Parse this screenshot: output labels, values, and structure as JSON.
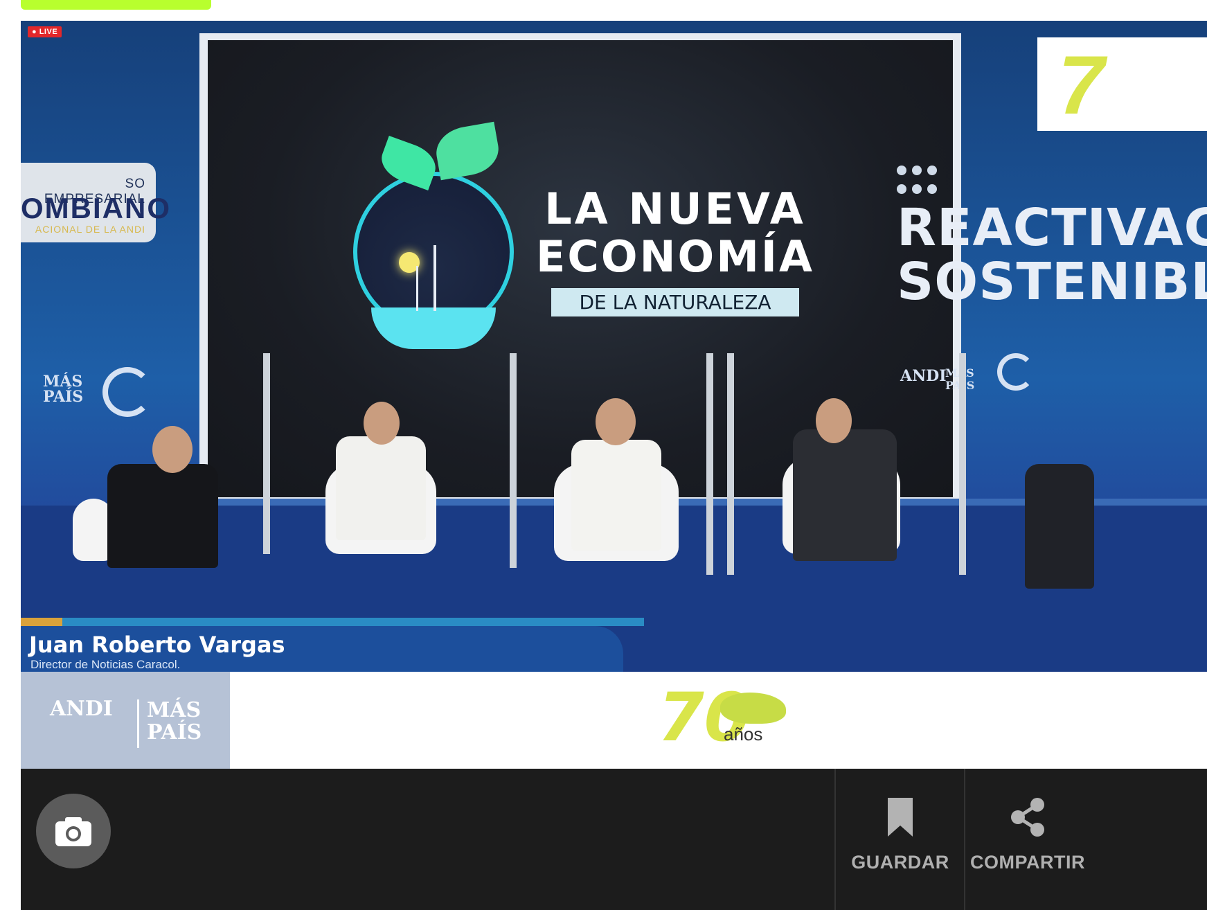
{
  "live_badge": "● LIVE",
  "stage": {
    "screen_title_line1": "LA NUEVA",
    "screen_title_line2": "ECONOMÍA",
    "screen_subtitle": "DE LA NATURALEZA",
    "left_sign_line1": "SO EMPRESARIAL",
    "left_sign_line2": "OMBIANO",
    "left_sign_line3": "ACIONAL DE LA ANDI",
    "left_logo_mas": "MÁS",
    "left_logo_pais": "PAÍS",
    "right_title_line1": "REACTIVAC",
    "right_title_line2": "SOSTENIBL",
    "right_logo_andi": "ANDI",
    "right_logo_maspais": "MÁS PAÍS",
    "right_logo_box_text": "7"
  },
  "lower_third": {
    "name": "Juan Roberto Vargas",
    "role": "Director de Noticias Caracol."
  },
  "banner": {
    "andi": "ANDI",
    "mas": "MÁS",
    "pais": "PAÍS",
    "seventy": "70",
    "anos": "años"
  },
  "controls": {
    "save_label": "GUARDAR",
    "share_label": "COMPARTIR"
  },
  "icons": {
    "camera": "camera-icon",
    "bookmark": "bookmark-icon",
    "share": "share-icon"
  }
}
